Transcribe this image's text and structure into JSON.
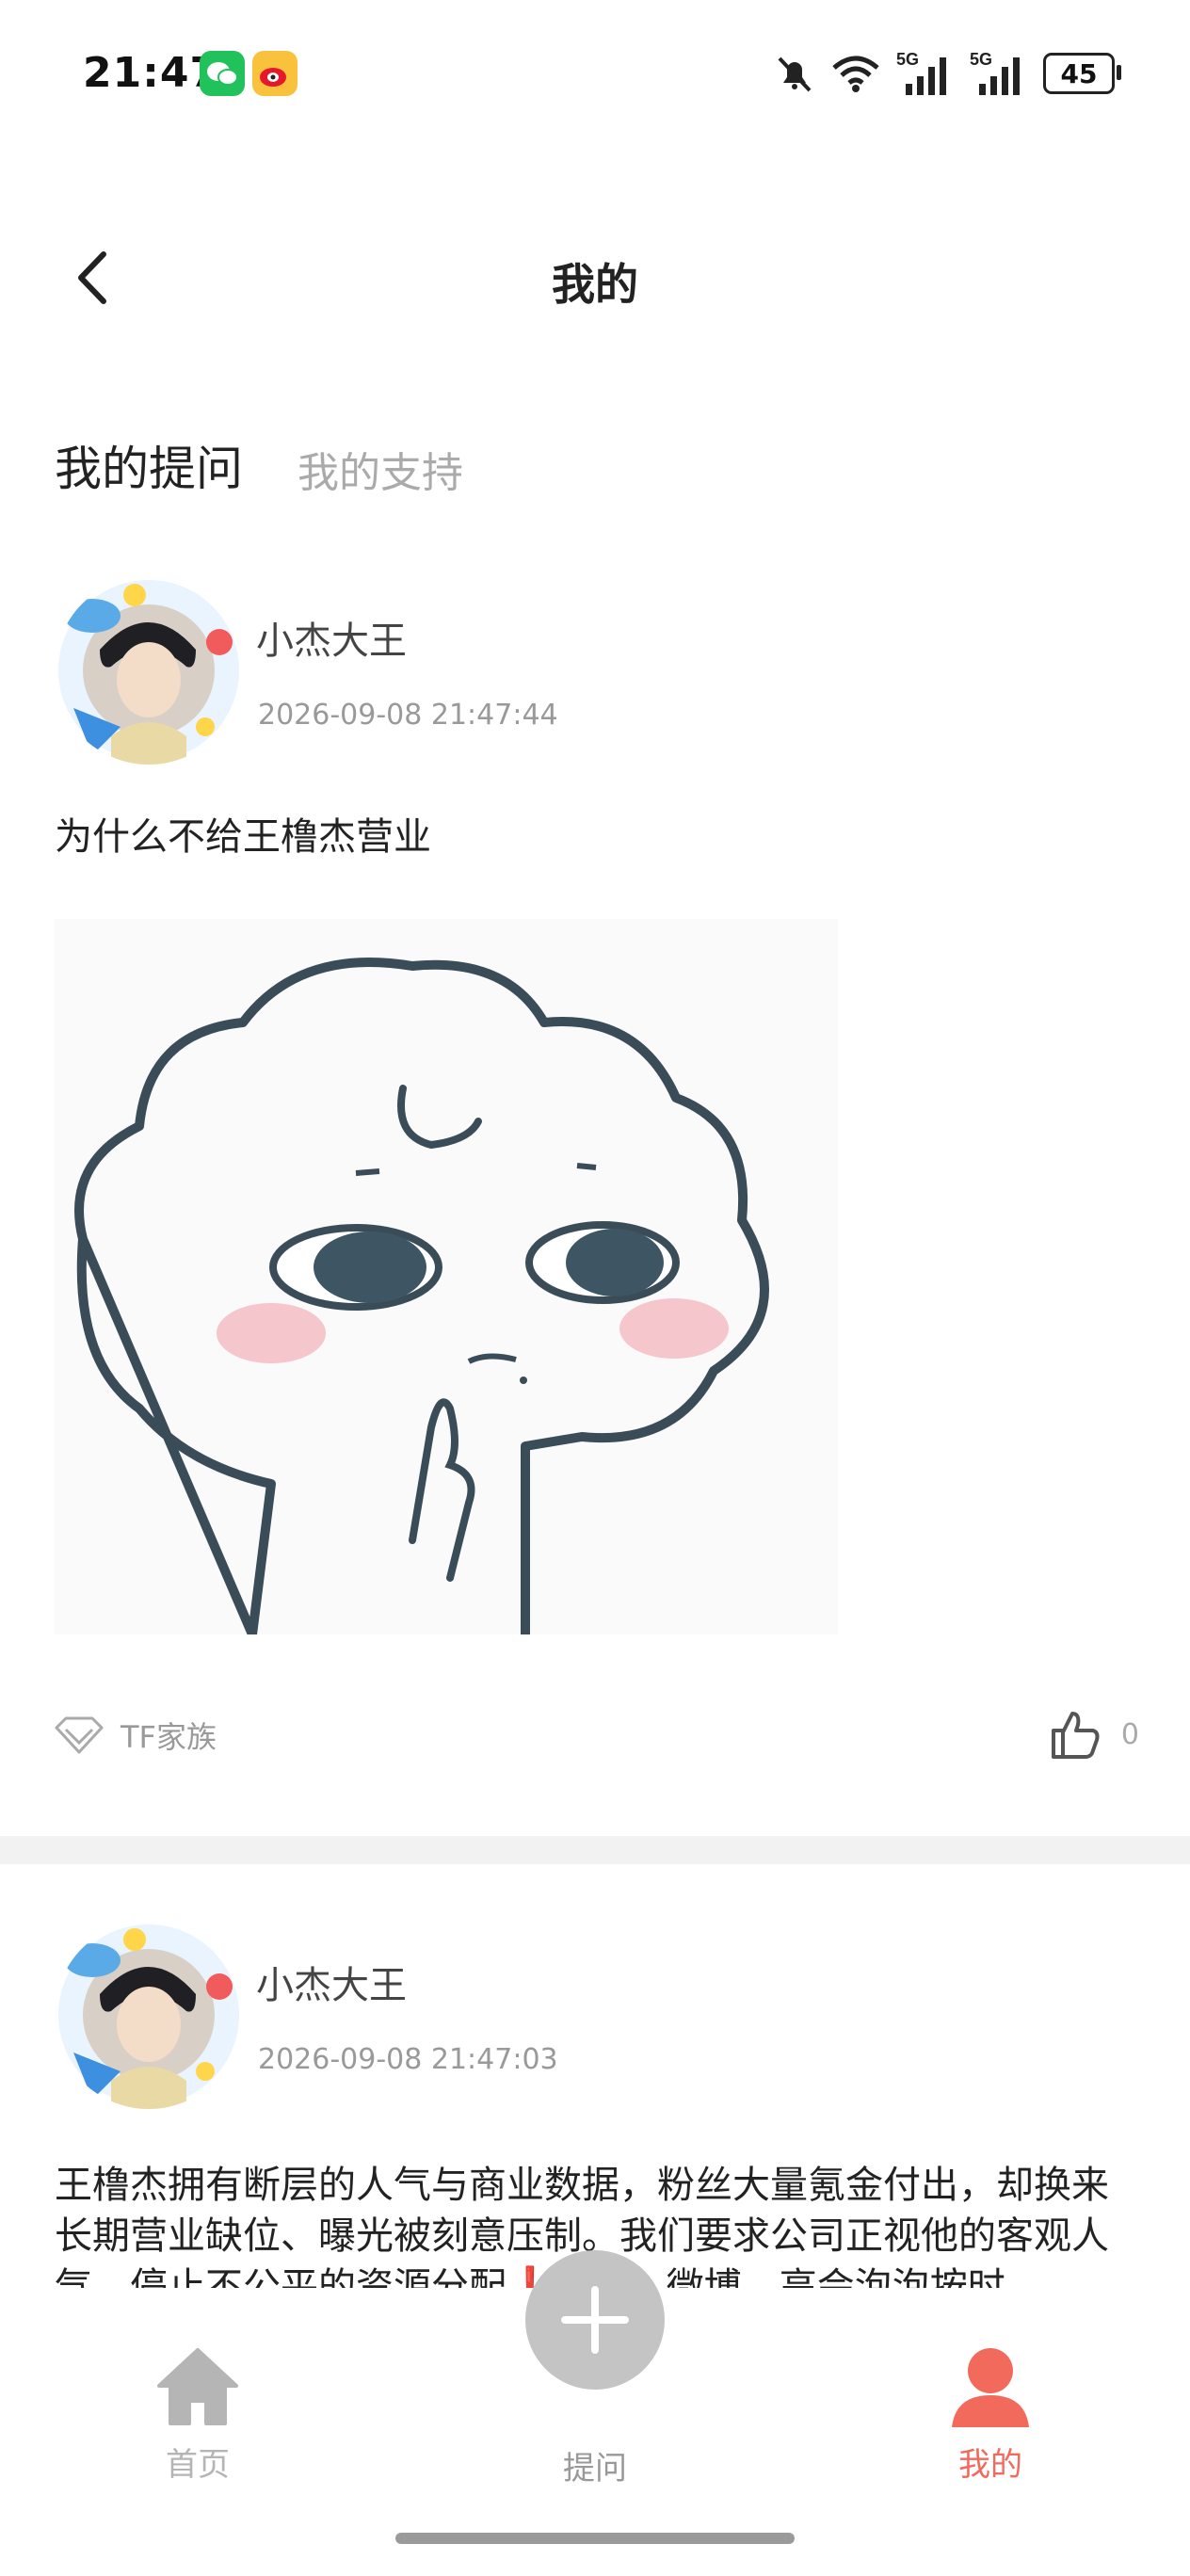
{
  "status_bar": {
    "time": "21:47",
    "battery": "45",
    "icons": [
      "wechat-icon",
      "weibo-icon",
      "mute-bell-icon",
      "wifi-icon",
      "signal-5g-icon",
      "signal-5g-icon",
      "battery-icon"
    ]
  },
  "header": {
    "title": "我的"
  },
  "tabs": [
    {
      "label": "我的提问",
      "active": true
    },
    {
      "label": "我的支持",
      "active": false
    }
  ],
  "posts": [
    {
      "author": "小杰大王",
      "time": "2026-09-08 21:47:44",
      "text": "为什么不给王橹杰营业",
      "tag": "TF家族",
      "likes": "0"
    },
    {
      "author": "小杰大王",
      "time": "2026-09-08 21:47:03",
      "text": "王橹杰拥有断层的人气与商业数据，粉丝大量氪金付出，却换来长期营业缺位、曝光被刻意压制。我们要求公司正视他的客观人气，停止不公平的资源分配❗️抖音、微博、高会泡泡按时 ..."
    }
  ],
  "bottom_nav": {
    "home": "首页",
    "ask": "提问",
    "mine": "我的"
  },
  "colors": {
    "accent": "#f26a5c",
    "inactive": "#b5b5b5"
  }
}
